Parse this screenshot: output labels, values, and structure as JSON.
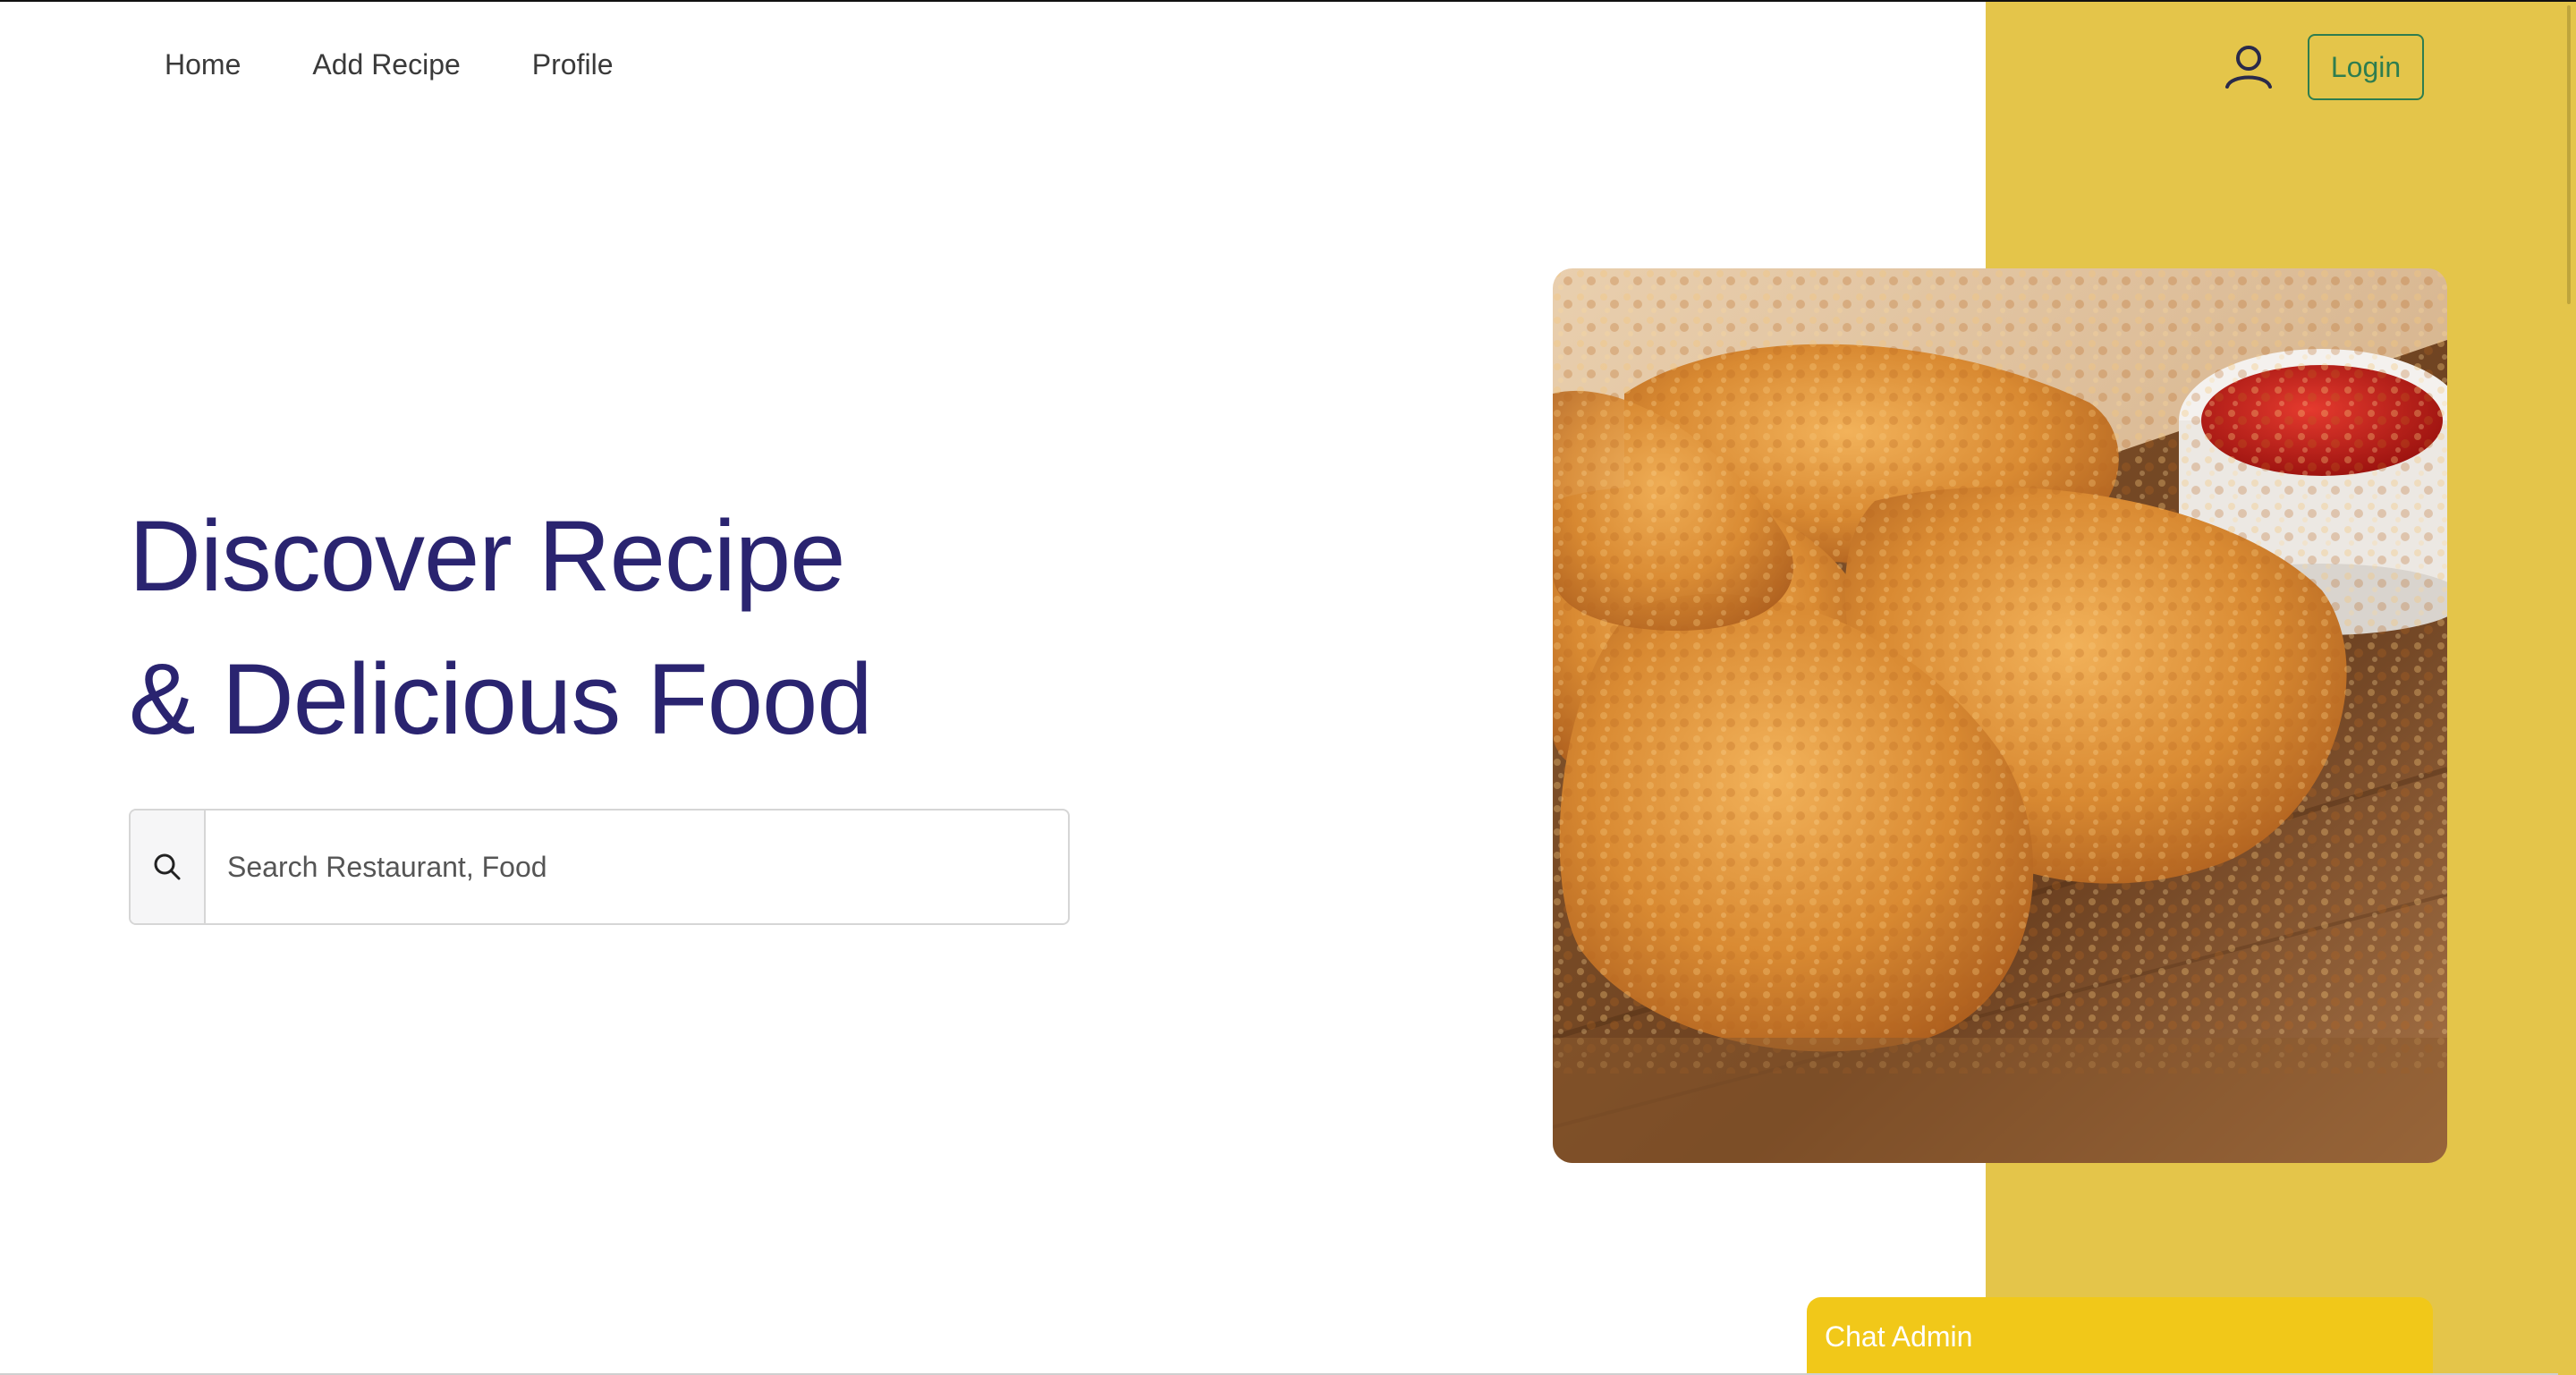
{
  "nav": {
    "items": [
      {
        "label": "Home"
      },
      {
        "label": "Add Recipe"
      },
      {
        "label": "Profile"
      }
    ]
  },
  "header": {
    "user_icon": "user-icon",
    "login_label": "Login"
  },
  "hero": {
    "title_line1": "Discover Recipe",
    "title_line2": "& Delicious Food",
    "image_icon": "fried-chicken-photo"
  },
  "search": {
    "icon": "search-icon",
    "placeholder": "Search Restaurant, Food",
    "value": ""
  },
  "chat": {
    "label": "Chat Admin"
  },
  "colors": {
    "accent_panel": "#E4C54A",
    "chat_bar": "#F1C819",
    "title": "#2A2470",
    "login_border": "#2e7d4f"
  }
}
